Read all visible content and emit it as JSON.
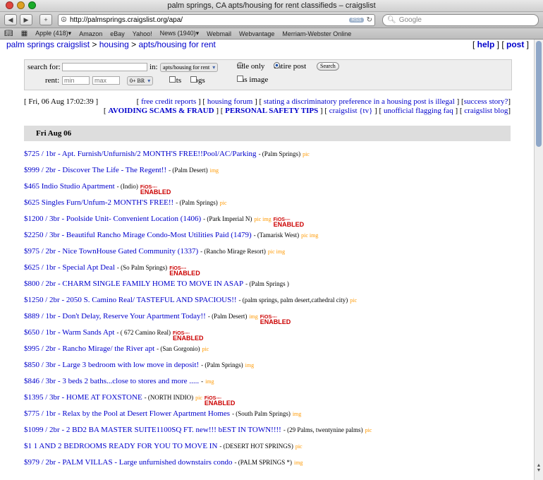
{
  "window": {
    "title": "palm springs, CA apts/housing for rent classifieds – craigslist"
  },
  "toolbar": {
    "url": "http://palmsprings.craigslist.org/apa/",
    "rss": "RSS",
    "search_placeholder": "Google"
  },
  "bookmarks": [
    "Apple (418)▾",
    "Amazon",
    "eBay",
    "Yahoo!",
    "News (1940)▾",
    "Webmail",
    "Webvantage",
    "Merriam-Webster Online"
  ],
  "breadcrumb": {
    "site": "palm springs craigslist",
    "sep1": " > ",
    "cat": "housing",
    "sep2": " > ",
    "sub": "apts/housing for rent"
  },
  "top_links": {
    "help": "help",
    "post": "post"
  },
  "search": {
    "search_label": "search for:",
    "in_label": "in:",
    "category": "apts/housing for rent",
    "title_only": "title only",
    "entire_post": "entire post",
    "search_button": "Search",
    "rent_label": "rent:",
    "min_placeholder": "min",
    "max_placeholder": "max",
    "br": "0+ BR",
    "cats": "cats",
    "dogs": "dogs",
    "has_image": "has image"
  },
  "date": "[ Fri, 06 Aug 17:02:39 ]",
  "links": {
    "l1": "free credit reports",
    "l2": "housing forum",
    "l3": "stating a discriminatory preference in a housing post is illegal",
    "l4": "success story?",
    "l5": "AVOIDING SCAMS & FRAUD",
    "l6": "PERSONAL SAFETY TIPS",
    "l7": "craigslist {tv}",
    "l8": "unofficial flagging faq",
    "l9": "craigslist blog"
  },
  "day_header": "Fri Aug 06",
  "fios": {
    "line1": "FiOS▫▫▫",
    "line2": "ENABLED"
  },
  "listings": [
    {
      "title": "$725 / 1br - Apt. Furnish/Unfurnish/2 MONTH'S FREE!!Pool/AC/Parking",
      "loc": " - (Palm Springs)",
      "tag": "pic",
      "fios": false
    },
    {
      "title": "$999 / 2br - Discover The Life - The Regent!!",
      "loc": " - (Palm Desert)",
      "tag": "img",
      "fios": false
    },
    {
      "title": "$465 Indio Studio Apartment",
      "loc": " - (Indio)",
      "tag": "",
      "fios": true
    },
    {
      "title": "$625 Singles Furn/Unfum-2 MONTH'S FREE!!",
      "loc": " - (Palm Springs)",
      "tag": "pic",
      "fios": false
    },
    {
      "title": "$1200 / 3br - Poolside Unit- Convenient Location (1406)",
      "loc": " - (Park Imperial N)",
      "tag": "pic img",
      "fios": true
    },
    {
      "title": "$2250 / 3br - Beautiful Rancho Mirage Condo-Most Utilities Paid (1479)",
      "loc": " - (Tamarisk West)",
      "tag": "pic img",
      "fios": false
    },
    {
      "title": "$975 / 2br - Nice TownHouse Gated Community (1337)",
      "loc": " - (Rancho Mirage Resort)",
      "tag": "pic img",
      "fios": false
    },
    {
      "title": "$625 / 1br - Special Apt Deal",
      "loc": " - (So Palm Springs)",
      "tag": "",
      "fios": true
    },
    {
      "title": "$800 / 2br - CHARM SINGLE FAMILY HOME TO MOVE IN ASAP",
      "loc": " - (Palm Springs )",
      "tag": "",
      "fios": false
    },
    {
      "title": "$1250 / 2br - 2050 S. Camino Real/ TASTEFUL AND SPACIOUS!!",
      "loc": " - (palm springs, palm desert,cathedral city)",
      "tag": "pic",
      "fios": false
    },
    {
      "title": "$889 / 1br - Don't Delay, Reserve Your Apartment Today!!",
      "loc": " - (Palm Desert)",
      "tag": "img",
      "fios": true
    },
    {
      "title": "$650 / 1br - Warm Sands Apt",
      "loc": " - ( 672 Camino Real)",
      "tag": "",
      "fios": true
    },
    {
      "title": "$995 / 2br - Rancho Mirage/ the River apt",
      "loc": " - (San Gorgonio)",
      "tag": "pic",
      "fios": false
    },
    {
      "title": "$850 / 3br - Large 3 bedroom with low move in deposit!",
      "loc": " - (Palm Springs)",
      "tag": "img",
      "fios": false
    },
    {
      "title": "$846 / 3br - 3 beds 2 baths...close to stores and more .....",
      "loc": " -",
      "tag": "img",
      "fios": false
    },
    {
      "title": "$1395 / 3br - HOME AT FOXSTONE",
      "loc": " - (NORTH INDIO)",
      "tag": "pic",
      "fios": true
    },
    {
      "title": "$775 / 1br - Relax by the Pool at Desert Flower Apartment Homes",
      "loc": " - (South Palm Springs)",
      "tag": "img",
      "fios": false
    },
    {
      "title": "$1099 / 2br - 2 BD2 BA MASTER SUITE1100SQ FT. new!!! bEST IN TOWN!!!!",
      "loc": " - (29 Palms, twentynine palms)",
      "tag": "pic",
      "fios": false
    },
    {
      "title": "$1 1 AND 2 BEDROOMS READY FOR YOU TO MOVE IN",
      "loc": " - (DESERT HOT SPRINGS)",
      "tag": "pic",
      "fios": false
    },
    {
      "title": "$979 / 2br - PALM VILLAS - Large unfurnished downstairs condo",
      "loc": " - (PALM SPRINGS *)",
      "tag": "img",
      "fios": false
    }
  ]
}
